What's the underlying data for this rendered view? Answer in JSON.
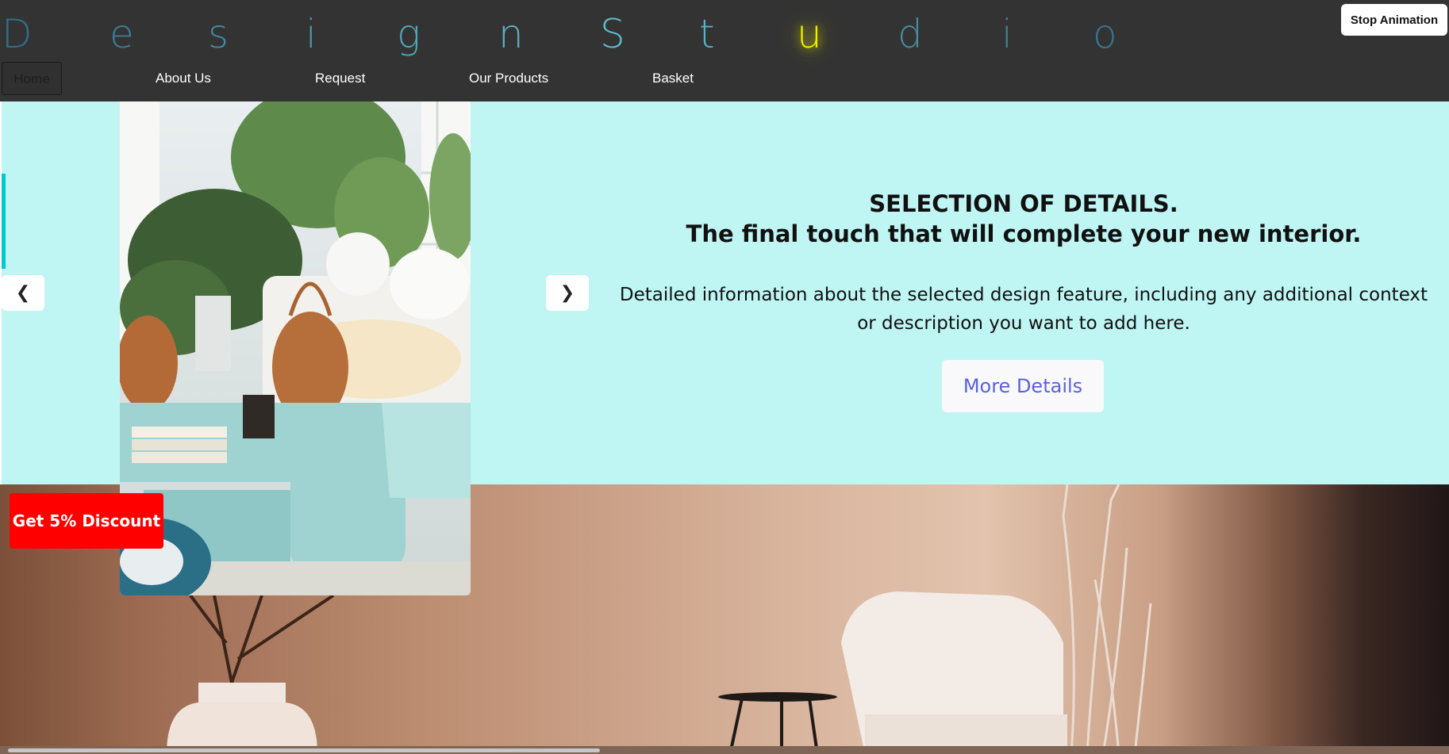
{
  "logo": {
    "letters": [
      {
        "char": "D",
        "color": "#2f6f87"
      },
      {
        "char": "e",
        "color": "#3a7e96"
      },
      {
        "char": "s",
        "color": "#438aa0"
      },
      {
        "char": "i",
        "color": "#4c97ab"
      },
      {
        "char": "g",
        "color": "#52a3b6"
      },
      {
        "char": "n",
        "color": "#5ab0c2"
      },
      {
        "char": "S",
        "color": "#60bccd"
      },
      {
        "char": "t",
        "color": "#55b3c8"
      },
      {
        "char": "u",
        "color": "#f0f000"
      },
      {
        "char": "d",
        "color": "#4a8ba0"
      },
      {
        "char": "i",
        "color": "#3f8197"
      },
      {
        "char": "o",
        "color": "#37768f"
      }
    ],
    "highlight_color": "#f0f000"
  },
  "header": {
    "stop_animation_label": "Stop Animation"
  },
  "nav": {
    "items": [
      "Home",
      "About Us",
      "Request",
      "Our Products",
      "Basket"
    ]
  },
  "slide": {
    "title_line1": "SELECTION OF DETAILS.",
    "title_line2": "The final touch that will complete your new interior.",
    "description": "Detailed information about the selected design feature, including any additional context or description you want to add here.",
    "more_details_label": "More Details",
    "prev_arrow": "❮",
    "next_arrow": "❯",
    "panel_color": "#bff5f3"
  },
  "promo": {
    "discount_label": "Get 5% Discount",
    "color": "#ff0000"
  },
  "icons": {
    "prev": "chevron-left-icon",
    "next": "chevron-right-icon"
  }
}
